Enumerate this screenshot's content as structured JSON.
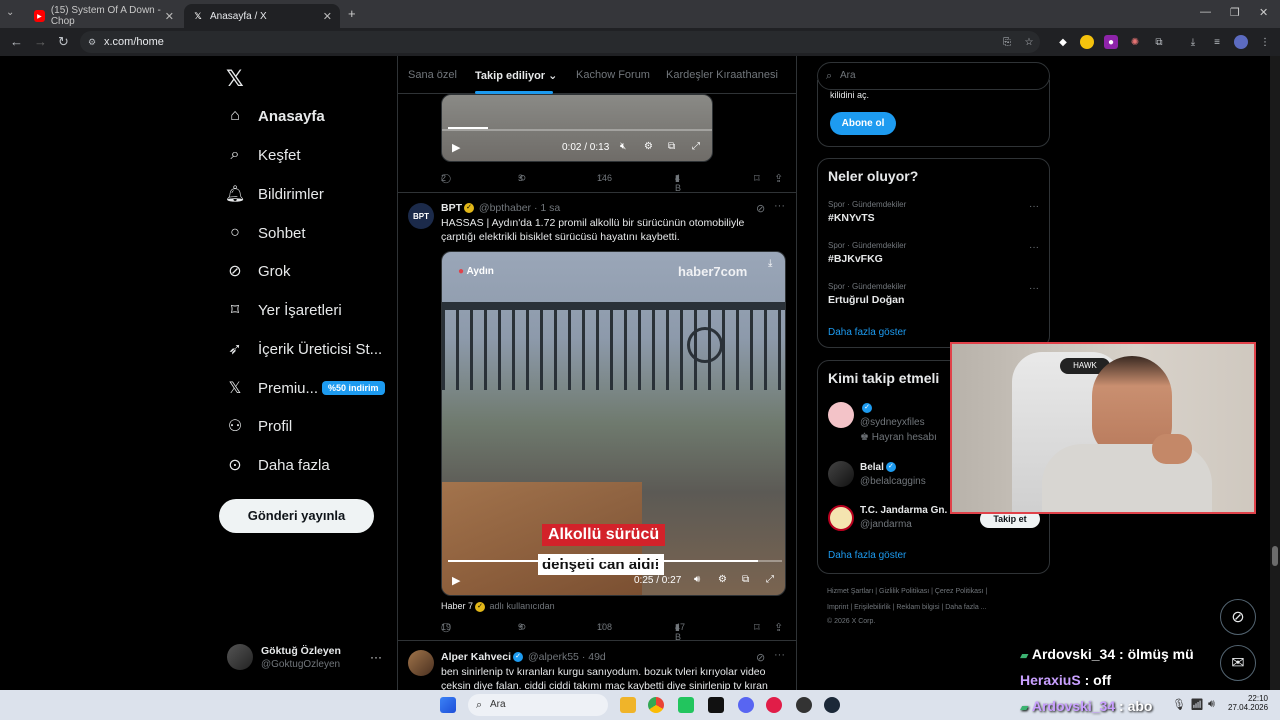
{
  "browser": {
    "tabs": [
      {
        "title": "(15) System Of A Down - Chop",
        "favicon": "youtube-icon"
      },
      {
        "title": "Anasayfa / X",
        "favicon": "x-logo-icon"
      }
    ],
    "url": "x.com/home"
  },
  "sidebar": {
    "items": [
      {
        "label": "Anasayfa",
        "icon": "home-icon"
      },
      {
        "label": "Keşfet",
        "icon": "search-icon"
      },
      {
        "label": "Bildirimler",
        "icon": "bell-icon"
      },
      {
        "label": "Sohbet",
        "icon": "chat-icon"
      },
      {
        "label": "Grok",
        "icon": "grok-icon"
      },
      {
        "label": "Yer İşaretleri",
        "icon": "bookmark-icon"
      },
      {
        "label": "İçerik Üreticisi St...",
        "icon": "rocket-icon"
      },
      {
        "label": "Premiu...",
        "icon": "x-logo-icon"
      },
      {
        "label": "Profil",
        "icon": "person-icon"
      },
      {
        "label": "Daha fazla",
        "icon": "more-circle-icon"
      }
    ],
    "premium_badge": "%50 indirim",
    "post_button": "Gönderi yayınla",
    "account": {
      "name": "Göktuğ Özleyen",
      "handle": "@GoktugOzleyen"
    }
  },
  "feed": {
    "tabs": [
      "Sana özel",
      "Takip ediliyor",
      "Kachow Forum",
      "Kardeşler Kıraathanesi"
    ],
    "tweet0": {
      "video_time": "0:02 / 0:13",
      "replies": "2",
      "reposts": "3",
      "likes": "146",
      "views": "4 B"
    },
    "tweet1": {
      "name": "BPT",
      "handle": "@bpthaber",
      "time": "· 1 sa",
      "text": "HASSAS | Aydın'da 1.72 promil alkollü bir sürücünün otomobiliyle çarptığı elektrikli bisiklet sürücüsü hayatını kaybetti.",
      "video_location": "Aydın",
      "video_brand": "haber7com",
      "caption_line1": "Alkollü sürücü",
      "caption_line2": "dehşeti can aldı!",
      "video_time": "0:25 / 0:27",
      "source": "Haber 7",
      "source_suffix": "adlı kullanıcıdan",
      "replies": "19",
      "reposts": "9",
      "likes": "108",
      "views": "47 B"
    },
    "tweet2": {
      "name": "Alper Kahveci",
      "handle": "@alperk55",
      "time": "· 49d",
      "text": "ben sinirlenip tv kıranları kurgu sanıyodum. bozuk tvleri kırıyolar video çeksin diye falan. ciddi ciddi takımı maç kaybetti diye sinirlenip tv kıran"
    }
  },
  "right": {
    "search_placeholder": "Ara",
    "subscribe_partial": "kilidini aç.",
    "subscribe_button": "Abone ol",
    "trends_title": "Neler oluyor?",
    "trends": [
      {
        "category": "Spor · Gündemdekiler",
        "name": "#KNYvTS"
      },
      {
        "category": "Spor · Gündemdekiler",
        "name": "#BJKvFKG"
      },
      {
        "category": "Spor · Gündemdekiler",
        "name": "Ertuğrul Doğan"
      }
    ],
    "show_more": "Daha fazla göster",
    "follow_title": "Kimi takip etmeli",
    "follows": [
      {
        "name": "",
        "handle": "@sydneyxfiles",
        "extra": "Hayran hesabı"
      },
      {
        "name": "Belal",
        "handle": "@belalcaggins",
        "extra": ""
      },
      {
        "name": "T.C. Jandarma Gn.",
        "handle": "@jandarma",
        "extra": ""
      }
    ],
    "follow_button": "Takip et",
    "footer1": "Hizmet Şartları  |  Gizlilik Politikası  |  Çerez Politikası  |",
    "footer2": "Imprint  |  Erişilebilirlik  |  Reklam bilgisi  |  Daha fazla ...",
    "footer3": "© 2026 X Corp."
  },
  "chat": [
    {
      "user": "Ardovski_34",
      "message": " : ölmüş mü",
      "color": "#b9a7f5"
    },
    {
      "user": "HeraxiuS",
      "message": " : off",
      "color": "#b9a7f5"
    },
    {
      "user": "Ardovski_34",
      "message": " : abo",
      "color": "#b9a7f5"
    }
  ],
  "taskbar": {
    "search": "Ara",
    "time": "22:10",
    "date": "27.04.2026"
  }
}
